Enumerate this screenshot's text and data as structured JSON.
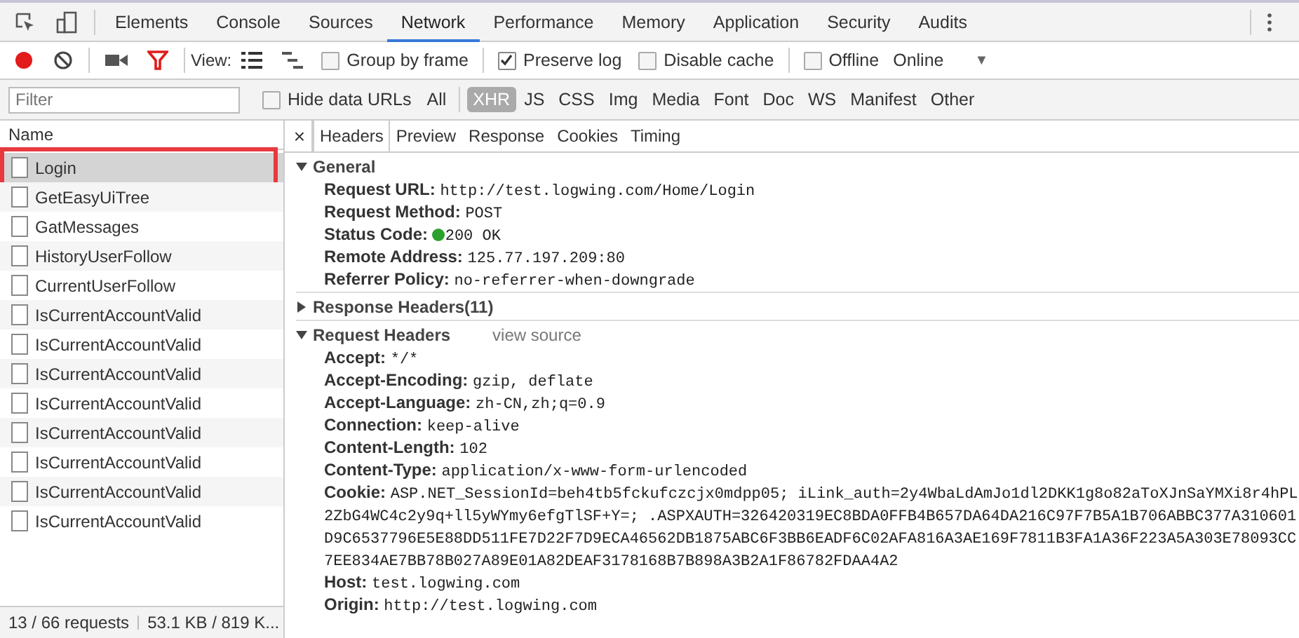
{
  "panel_tabs": [
    {
      "label": "Elements",
      "selected": false
    },
    {
      "label": "Console",
      "selected": false
    },
    {
      "label": "Sources",
      "selected": false
    },
    {
      "label": "Network",
      "selected": true
    },
    {
      "label": "Performance",
      "selected": false
    },
    {
      "label": "Memory",
      "selected": false
    },
    {
      "label": "Application",
      "selected": false
    },
    {
      "label": "Security",
      "selected": false
    },
    {
      "label": "Audits",
      "selected": false
    }
  ],
  "toolbar": {
    "recording": true,
    "filter_on": true,
    "view_label": "View:",
    "large_rows": true,
    "options": [
      {
        "label": "Group by frame",
        "checked": false
      },
      {
        "label": "Preserve log",
        "checked": true
      },
      {
        "label": "Disable cache",
        "checked": false
      }
    ],
    "offline": {
      "label": "Offline",
      "checked": false
    },
    "throttling": "Online",
    "throttling_arrow": "▼"
  },
  "filter_bar": {
    "placeholder": "Filter",
    "hide_data_urls": {
      "label": "Hide data URLs",
      "checked": false
    },
    "types": [
      {
        "label": "All",
        "selected": false
      },
      {
        "label": "XHR",
        "selected": true
      },
      {
        "label": "JS",
        "selected": false
      },
      {
        "label": "CSS",
        "selected": false
      },
      {
        "label": "Img",
        "selected": false
      },
      {
        "label": "Media",
        "selected": false
      },
      {
        "label": "Font",
        "selected": false
      },
      {
        "label": "Doc",
        "selected": false
      },
      {
        "label": "WS",
        "selected": false
      },
      {
        "label": "Manifest",
        "selected": false
      },
      {
        "label": "Other",
        "selected": false
      }
    ]
  },
  "requests": {
    "column": "Name",
    "rows": [
      {
        "name": "Login",
        "selected": true,
        "highlighted": true
      },
      {
        "name": "GetEasyUiTree",
        "selected": false,
        "highlighted": false
      },
      {
        "name": "GatMessages",
        "selected": false,
        "highlighted": false
      },
      {
        "name": "HistoryUserFollow",
        "selected": false,
        "highlighted": false
      },
      {
        "name": "CurrentUserFollow",
        "selected": false,
        "highlighted": false
      },
      {
        "name": "IsCurrentAccountValid",
        "selected": false,
        "highlighted": false
      },
      {
        "name": "IsCurrentAccountValid",
        "selected": false,
        "highlighted": false
      },
      {
        "name": "IsCurrentAccountValid",
        "selected": false,
        "highlighted": false
      },
      {
        "name": "IsCurrentAccountValid",
        "selected": false,
        "highlighted": false
      },
      {
        "name": "IsCurrentAccountValid",
        "selected": false,
        "highlighted": false
      },
      {
        "name": "IsCurrentAccountValid",
        "selected": false,
        "highlighted": false
      },
      {
        "name": "IsCurrentAccountValid",
        "selected": false,
        "highlighted": false
      },
      {
        "name": "IsCurrentAccountValid",
        "selected": false,
        "highlighted": false
      }
    ]
  },
  "status_bar": {
    "requests": "13 / 66 requests",
    "transferred": "53.1 KB / 819 K..."
  },
  "detail_tabs": {
    "close": "×",
    "tabs": [
      {
        "label": "Headers",
        "selected": true
      },
      {
        "label": "Preview",
        "selected": false
      },
      {
        "label": "Response",
        "selected": false
      },
      {
        "label": "Cookies",
        "selected": false
      },
      {
        "label": "Timing",
        "selected": false
      }
    ]
  },
  "sections": [
    {
      "title": "General",
      "expanded": true,
      "rows": [
        {
          "name": "Request URL:",
          "value": "http://test.logwing.com/Home/Login"
        },
        {
          "name": "Request Method:",
          "value": "POST"
        },
        {
          "name": "Status Code:",
          "value": "200 OK",
          "color": "#2ca02c"
        },
        {
          "name": "Remote Address:",
          "value": "125.77.197.209:80"
        },
        {
          "name": "Referrer Policy:",
          "value": "no-referrer-when-downgrade"
        }
      ]
    },
    {
      "title": "Response Headers",
      "count": "(11)",
      "expanded": false
    },
    {
      "title": "Request Headers",
      "link": "view source",
      "expanded": true,
      "rows": [
        {
          "name": "Accept:",
          "value": "*/*"
        },
        {
          "name": "Accept-Encoding:",
          "value": "gzip, deflate"
        },
        {
          "name": "Accept-Language:",
          "value": "zh-CN,zh;q=0.9"
        },
        {
          "name": "Connection:",
          "value": "keep-alive"
        },
        {
          "name": "Content-Length:",
          "value": "102"
        },
        {
          "name": "Content-Type:",
          "value": "application/x-www-form-urlencoded"
        },
        {
          "name": "Cookie:",
          "value": "ASP.NET_SessionId=beh4tb5fckufczcjx0mdpp05; iLink_auth=2y4WbaLdAmJo1dl2DKK1g8o82aToXJnSaYMXi8r4hPL2ZbG4WC4c2y9q+ll5yWYmy6efgTlSF+Y=; .ASPXAUTH=326420319EC8BDA0FFB4B657DA64DA216C97F7B5A1B706ABBC377A310601D9C6537796E5E88DD511FE7D22F7D9ECA46562DB1875ABC6F3BB6EADF6C02AFA816A3AE169F7811B3FA1A36F223A5A303E78093CC7EE834AE7BB78B027A89E01A82DEAF3178168B7B898A3B2A1F86782FDAA4A2"
        },
        {
          "name": "Host:",
          "value": "test.logwing.com"
        },
        {
          "name": "Origin:",
          "value": "http://test.logwing.com"
        }
      ]
    }
  ]
}
